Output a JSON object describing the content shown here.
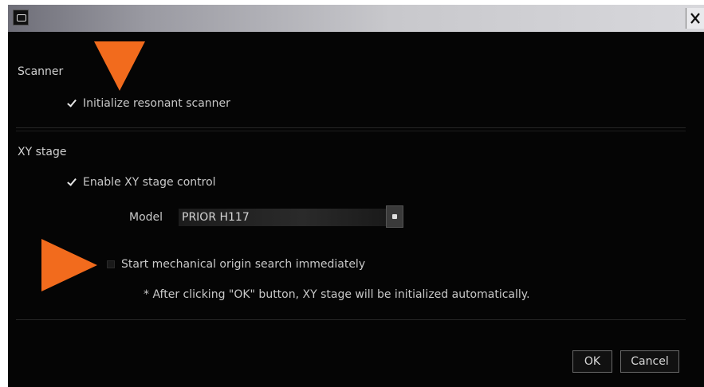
{
  "icons": {
    "app": "window-icon",
    "close": "close-icon",
    "check": "checkmark-icon",
    "dropdown": "dropdown-icon",
    "annotation_down": "orange-down-arrow",
    "annotation_right": "orange-right-arrow"
  },
  "colors": {
    "background": "#050505",
    "text": "#c8c8c8",
    "annotation": "#f26b1d"
  },
  "scanner": {
    "title": "Scanner",
    "initialize_label": "Initialize resonant scanner",
    "initialize_checked": true
  },
  "xy_stage": {
    "title": "XY stage",
    "enable_label": "Enable XY stage control",
    "enable_checked": true,
    "model_label": "Model",
    "model_value": "PRIOR H117",
    "origin_label": "Start mechanical origin search immediately",
    "origin_checked": false,
    "note": "* After clicking \"OK\" button, XY stage will be initialized automatically."
  },
  "buttons": {
    "ok": "OK",
    "cancel": "Cancel"
  }
}
